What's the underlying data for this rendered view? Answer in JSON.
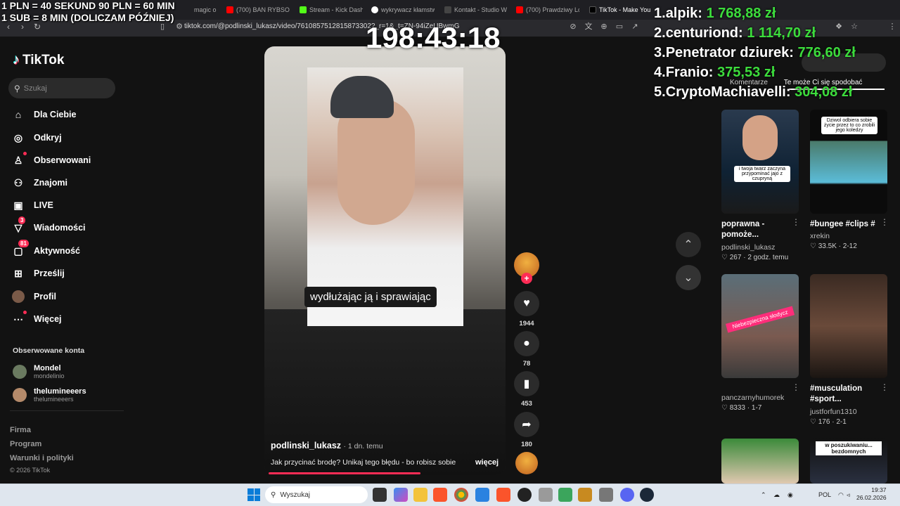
{
  "overlay": {
    "line1": "1 PLN = 40 SEKUND 90 PLN = 60 MIN",
    "line2": "1 SUB = 8 MIN (DOLICZAM PÓŹNIEJ)",
    "timer": "198:43:18"
  },
  "leaderboard": [
    {
      "rank": "1.",
      "name": "alpik:",
      "amount": "1 768,88 zł"
    },
    {
      "rank": "2.",
      "name": "centuriond:",
      "amount": "1 114,70 zł"
    },
    {
      "rank": "3.",
      "name": "Penetrator dziurek:",
      "amount": "776,60 zł"
    },
    {
      "rank": "4.",
      "name": "Franio:",
      "amount": "375,53 zł"
    },
    {
      "rank": "5.",
      "name": "CryptoMachiavelli:",
      "amount": "304,08 zł"
    }
  ],
  "browser": {
    "tabs": [
      "magic o",
      "(700) BAN RYBSON",
      "Stream - Kick Dashb",
      "wykrywacz kłamstw",
      "Kontakt - Studio W",
      "(700) Prawdziwy Lo",
      "TikTok - Make You"
    ],
    "url": "tiktok.com/@podlinski_lukasz/video/7610857512815873302?_r=1&_t=ZN-94iZeUBwmG"
  },
  "tiktok": {
    "logo": "TikTok",
    "search_placeholder": "Szukaj",
    "nav": [
      {
        "label": "Dla Ciebie",
        "icon": "home-icon"
      },
      {
        "label": "Odkryj",
        "icon": "compass-icon"
      },
      {
        "label": "Obserwowani",
        "icon": "following-icon"
      },
      {
        "label": "Znajomi",
        "icon": "friends-icon"
      },
      {
        "label": "LIVE",
        "icon": "live-icon"
      },
      {
        "label": "Wiadomości",
        "icon": "messages-icon",
        "badge": "3"
      },
      {
        "label": "Aktywność",
        "icon": "activity-icon",
        "badge": "81"
      },
      {
        "label": "Prześlij",
        "icon": "upload-icon"
      },
      {
        "label": "Profil",
        "icon": "profile-icon"
      },
      {
        "label": "Więcej",
        "icon": "more-icon"
      }
    ],
    "followed_heading": "Obserwowane konta",
    "followed": [
      {
        "name": "Mondel",
        "handle": "mondelinio"
      },
      {
        "name": "thelumineeers",
        "handle": "thelumineeers"
      }
    ],
    "footer": [
      "Firma",
      "Program",
      "Warunki i polityki",
      "© 2026 TikTok"
    ]
  },
  "video": {
    "caption": "wydłużając ją i sprawiając",
    "user": "podlinski_lukasz",
    "time": "· 1 dn. temu",
    "desc": "Jak przycinać brodę? Unikaj tego błędu - bo robisz sobie",
    "more": "więcej",
    "likes": "1944",
    "comments": "78",
    "saves": "453",
    "shares": "180",
    "progress": 0.64
  },
  "right": {
    "tabs": [
      "Komentarze",
      "Te może Ci się spodobać"
    ],
    "cards": [
      {
        "title": "poprawna - pomoże...",
        "user": "podlinski_lukasz",
        "likes": "267",
        "age": "2 godz. temu",
        "overlay": "i twoja twarz zaczyna przypominać jajo z czupryną"
      },
      {
        "title": "#bungee #clips #",
        "user": "xrekin",
        "likes": "33.5K",
        "age": "2-12",
        "overlay": "Dziwol odbiera sobie życie przez to co zrobili jego koledzy"
      },
      {
        "title": "",
        "user": "panczarnyhumorek",
        "likes": "8333",
        "age": "1-7",
        "overlay": "Niebezpieczna słodycz"
      },
      {
        "title": "#musculation #sport...",
        "user": "justforfun1310",
        "likes": "176",
        "age": "2-1",
        "overlay": ""
      },
      {
        "title": "",
        "user": "",
        "likes": "",
        "age": "",
        "overlay": ""
      },
      {
        "title": "",
        "user": "",
        "likes": "",
        "age": "",
        "overlay": "w poszukiwaniu... bezdomnych"
      }
    ]
  },
  "taskbar": {
    "search": "Wyszukaj",
    "lang": "POL",
    "time": "19:37",
    "date": "26.02.2026"
  }
}
